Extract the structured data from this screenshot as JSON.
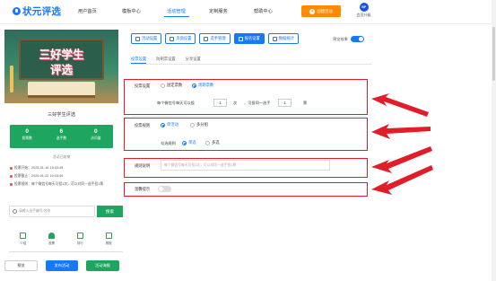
{
  "brand": {
    "name": "状元评选",
    "color": "#1677ff"
  },
  "nav": {
    "items": [
      "用户首页",
      "模板中心",
      "活动管理",
      "定制服务",
      "帮助中心"
    ],
    "active_index": 2
  },
  "header": {
    "create_label": "创建活动",
    "vip_badge": "VIP",
    "vip_label": "会员升级"
  },
  "preview": {
    "banner_line1": "三好学生",
    "banner_line2": "评选",
    "event_title": "三好学生评选",
    "stats": [
      {
        "value": "0",
        "label": "投票数"
      },
      {
        "value": "6",
        "label": "选手数"
      },
      {
        "value": "0",
        "label": "访问量"
      }
    ],
    "status": "活动已结束",
    "info": [
      "投票开始：2025-01-16 15:03:49",
      "投票截止：2025-01-22 15:03:49",
      "投票规则：每个微信号每天可投1次，可以对同一选手投1票"
    ],
    "search_placeholder": "请输入选手编号/名称",
    "search_button": "搜索",
    "tabs": [
      "介绍",
      "投票",
      "排行",
      "赛程"
    ],
    "buttons": [
      "预览",
      "发布活动",
      "活动海报"
    ]
  },
  "settings": {
    "tabs": [
      "活动设置",
      "页面设置",
      "选手管理",
      "报名设置",
      "数据统计"
    ],
    "active_tab": 3,
    "preview_toggle_label": "预览效果",
    "subtabs": [
      "投票设置",
      "防刷票设置",
      "分享设置"
    ],
    "vote_setting": {
      "label": "投票设置",
      "option_fixed": "固定票数",
      "option_cycle": "周期票数",
      "text_before": "每个微信号每天可以投",
      "times_value": "1",
      "times_unit": "次",
      "text_mid": "，可投同一选手",
      "votes_value": "1",
      "votes_unit": "票"
    },
    "vote_rule": {
      "label": "投票规则",
      "option_single_activity": "单活动",
      "option_multi_group": "多分组",
      "choose_label": "勾选规则",
      "option_single": "单选",
      "option_multi": "多选"
    },
    "rule_desc": {
      "label": "规则说明",
      "placeholder": "每个微信号每天可投1次，可以对同一选手投1票"
    },
    "vote_tip": {
      "label": "温馨提示"
    }
  },
  "colors": {
    "accent": "#1677ff",
    "green": "#1ea660",
    "orange": "#ff8a00",
    "annotation": "#e11d2a"
  }
}
